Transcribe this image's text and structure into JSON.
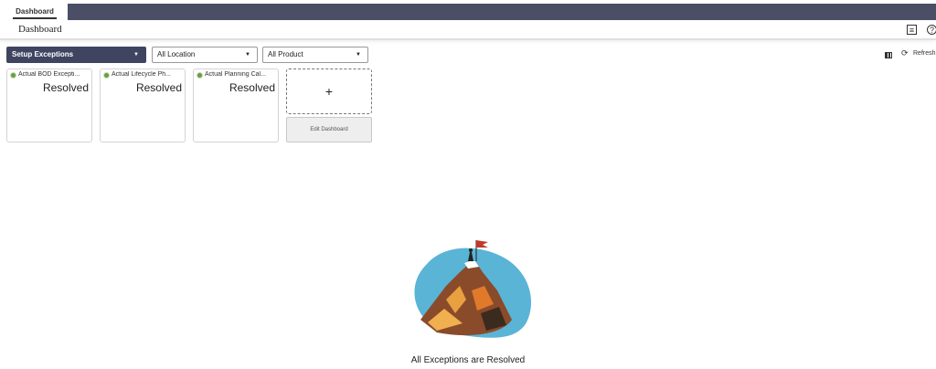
{
  "tabs": [
    {
      "label": "Dashboard"
    }
  ],
  "header": {
    "title": "Dashboard"
  },
  "filters": {
    "exception_type": "Setup Exceptions",
    "location": "All Location",
    "product": "All Product"
  },
  "toolbar": {
    "refresh_label": "Refresh"
  },
  "cards": [
    {
      "title": "Actual BOD Excepti...",
      "status": "Resolved"
    },
    {
      "title": "Actual Lifecycle Ph...",
      "status": "Resolved"
    },
    {
      "title": "Actual Planning Cal...",
      "status": "Resolved"
    }
  ],
  "add_tile": {
    "symbol": "+"
  },
  "edit_button": {
    "label": "Edit Dashboard"
  },
  "empty_state": {
    "message": "All Exceptions are Resolved"
  },
  "colors": {
    "nav_bar": "#4a4f66",
    "primary_select": "#3f4561",
    "status_dot": "#6a9f3f",
    "flag": "#c0392b"
  }
}
